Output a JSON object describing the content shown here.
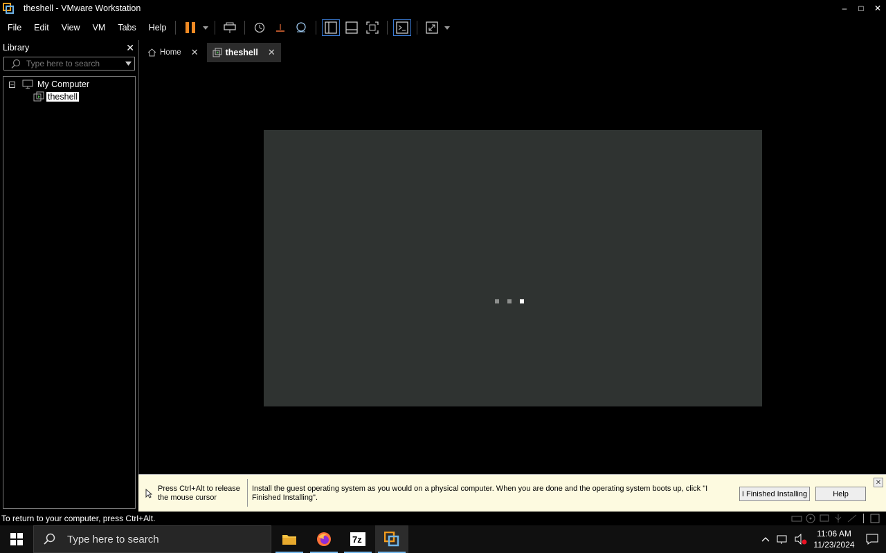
{
  "window": {
    "title": "theshell - VMware Workstation"
  },
  "menu": {
    "items": [
      "File",
      "Edit",
      "View",
      "VM",
      "Tabs",
      "Help"
    ]
  },
  "library": {
    "title": "Library",
    "search_placeholder": "Type here to search",
    "tree": {
      "root": "My Computer",
      "vm": "theshell"
    }
  },
  "tabs": [
    {
      "label": "Home"
    },
    {
      "label": "theshell"
    }
  ],
  "infobar": {
    "release_hint": "Press Ctrl+Alt to release the mouse cursor",
    "message": "Install the guest operating system as you would on a physical computer. When you are done and the operating system boots up, click \"I Finished Installing\".",
    "finished_button": "I Finished Installing",
    "help_button": "Help"
  },
  "status": {
    "text": "To return to your computer, press Ctrl+Alt."
  },
  "taskbar": {
    "search_placeholder": "Type here to search",
    "time": "11:06 AM",
    "date": "11/23/2024"
  },
  "colors": {
    "accent": "#3a7bd5",
    "guest_screen": "#2f3331",
    "infobar_bg": "#fdfae0"
  }
}
